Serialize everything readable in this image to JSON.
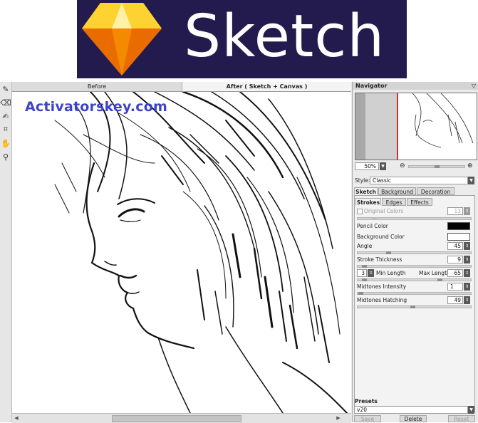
{
  "banner": {
    "brand": "Sketch",
    "colors": {
      "background": "#231b4d",
      "gem_top": "#fdd231",
      "gem_mid": "#fdad00",
      "gem_low": "#ea6c00",
      "gem_bottom": "#f48a00"
    }
  },
  "watermark": {
    "text": "Activatorskey.com",
    "color": "#3d43c8"
  },
  "toolbar": {
    "tools": [
      {
        "name": "pencil-icon",
        "glyph": "✎"
      },
      {
        "name": "eraser-icon",
        "glyph": "⌫"
      },
      {
        "name": "history-brush-icon",
        "glyph": "✍"
      },
      {
        "name": "crop-icon",
        "glyph": "⌗"
      },
      {
        "name": "hand-icon",
        "glyph": "✋"
      },
      {
        "name": "zoom-icon",
        "glyph": "⚲"
      }
    ]
  },
  "view_tabs": {
    "before": "Before",
    "after": "After ( Sketch + Canvas )"
  },
  "navigator": {
    "title": "Navigator",
    "zoom": "50%"
  },
  "style": {
    "label": "Style:",
    "value": "Classic"
  },
  "tabs": {
    "sketch": "Sketch",
    "background": "Background",
    "decoration": "Decoration"
  },
  "subtabs": {
    "strokes": "Strokes",
    "edges": "Edges",
    "effects": "Effects"
  },
  "params": {
    "original_colors": {
      "label": "Original Colors",
      "value": "13"
    },
    "pencil_color": {
      "label": "Pencil Color",
      "color": "#000000"
    },
    "background_color": {
      "label": "Background Color",
      "color": "#ffffff"
    },
    "angle": {
      "label": "Angle",
      "value": "45",
      "level": 0.5
    },
    "stroke_thickness": {
      "label": "Stroke Thickness",
      "value": "9",
      "level": 0.09
    },
    "min_length": {
      "label": "Min Length",
      "value": "3"
    },
    "max_length": {
      "label": "Max Length",
      "value": "65"
    },
    "midtones_intensity": {
      "label": "Midtones Intensity",
      "value": "1",
      "level": 0.01
    },
    "midtones_hatching": {
      "label": "Midtones Hatching",
      "value": "49",
      "level": 0.49
    }
  },
  "presets": {
    "title": "Presets",
    "value": "v20",
    "save": "Save",
    "delete": "Delete",
    "reset": "Reset"
  }
}
